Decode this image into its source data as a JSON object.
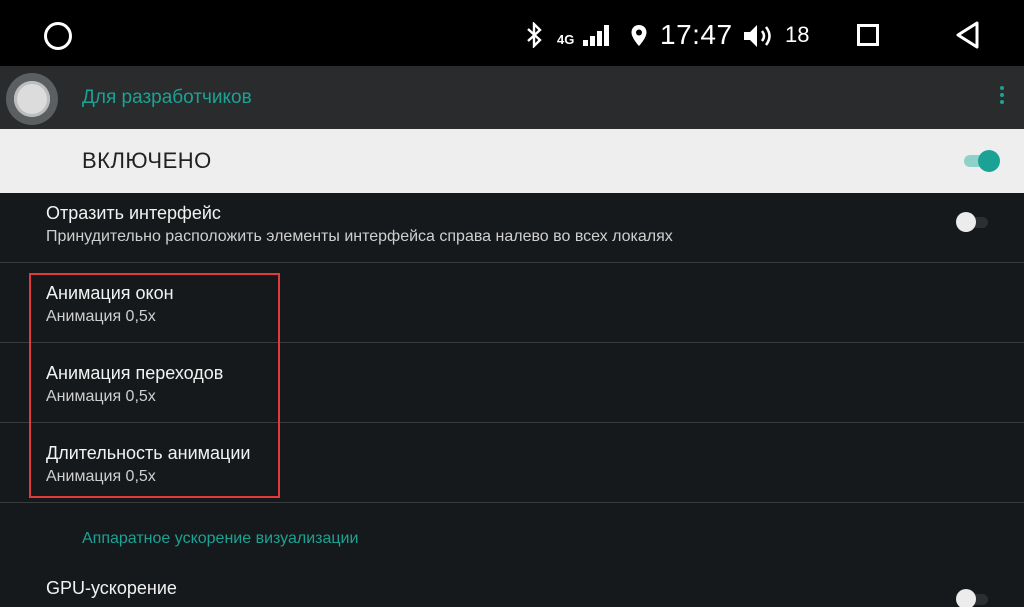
{
  "status_bar": {
    "network_label": "4G",
    "clock": "17:47",
    "volume_level": "18",
    "icons": [
      "home-circle-icon",
      "bluetooth-icon",
      "signal-icon",
      "location-icon",
      "volume-icon",
      "recents-square-icon",
      "back-triangle-icon"
    ]
  },
  "action_bar": {
    "title": "Для разработчиков"
  },
  "master_switch": {
    "label": "ВКЛЮЧЕНО",
    "checked": true
  },
  "preferences": [
    {
      "title": "Отразить интерфейс",
      "summary": "Принудительно расположить элементы интерфейса справа налево во всех локалях",
      "switch": false
    },
    {
      "title": "Анимация окон",
      "summary": "Анимация 0,5x"
    },
    {
      "title": "Анимация переходов",
      "summary": "Анимация 0,5x"
    },
    {
      "title": "Длительность анимации",
      "summary": "Анимация 0,5x"
    }
  ],
  "category": {
    "title": "Аппаратное ускорение визуализации"
  },
  "gpu_item": {
    "title": "GPU-ускорение",
    "switch": false
  },
  "colors": {
    "accent": "#1aa394",
    "highlight": "#e23a3a",
    "background": "#16191b",
    "action_bar": "#2a2b2c"
  }
}
